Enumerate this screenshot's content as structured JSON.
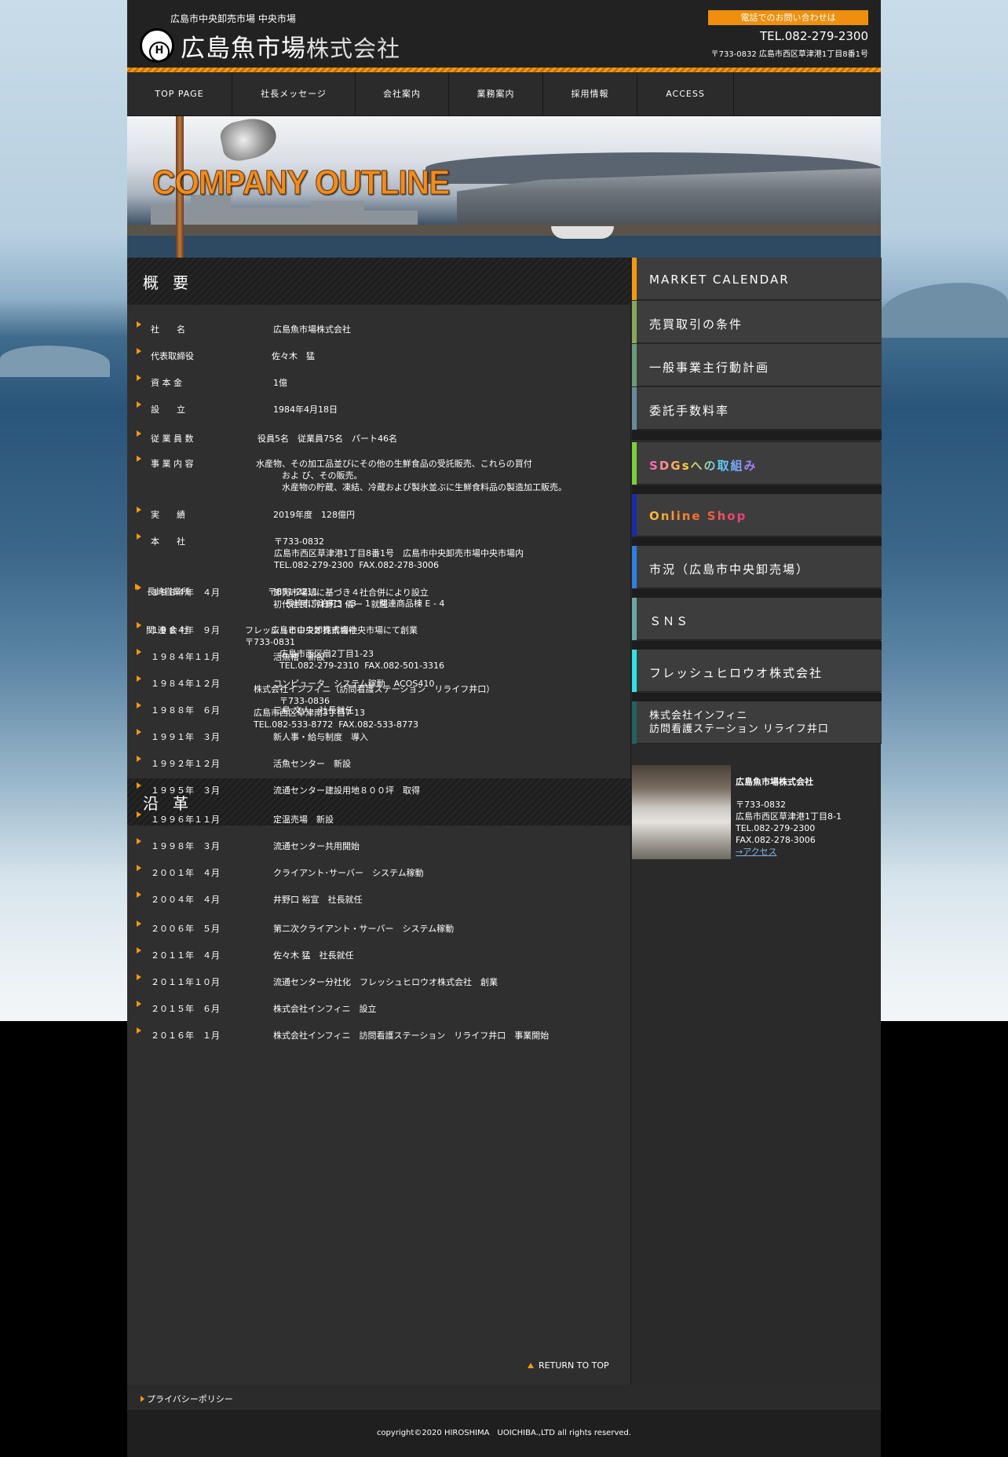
{
  "header": {
    "tagline": "広島市中央卸売市場 中央市場",
    "logo_main": "広島魚市場",
    "logo_suffix": "株式会社",
    "contact_button": "電話でのお問い合わせは",
    "tel": "TEL.082-279-2300",
    "address": "〒733-0832 広島市西区草津港1丁目8番1号"
  },
  "nav": [
    "TOP PAGE",
    "社長メッセージ",
    "会社案内",
    "業務案内",
    "採用情報",
    "ACCESS"
  ],
  "banner": {
    "title": "COMPANY OUTLINE"
  },
  "overview": {
    "heading": "概要",
    "rows": [
      {
        "label": "社　　名",
        "value": "広島魚市場株式会社"
      },
      {
        "label": "代表取締役",
        "value": "佐々木　猛"
      },
      {
        "label": "資 本 金",
        "value": "1億"
      },
      {
        "label": "設　　立",
        "value": "1984年4月18日"
      },
      {
        "label": "従 業 員 数",
        "value": "役員5名　従業員75名　パート46名"
      },
      {
        "label": "事 業 内 容",
        "value": "水産物、その加工品並びにその他の生鮮食品の受託販売、これらの買付\n　　　およ び、その販売。\n　　　水産物の貯蔵、凍結、冷蔵および製氷並ぶに生鮮食料品の製造加工販売。"
      },
      {
        "label": "実　　績",
        "value": "2019年度　128億円"
      },
      {
        "label": "本　　社",
        "value": "〒733-0832\n広島市西区草津港1丁目8番1号　広島市中央卸売市場中央市場内\nTEL.082-279-2300  FAX.082-278-3006"
      },
      {
        "label": "長崎営業所",
        "value": "〒851-2211\n　　長崎市京泊町3 - 3 - 1　関連商品棟 E - 4"
      },
      {
        "label": "関 連 会 社",
        "value": "フレッシュヒロウオ株式会社\n〒733-0831\n　　　　広島市西区扇2丁目1-23\n　　　　TEL.082-279-2310  FAX.082-501-3316\n\n　株式会社インフィニ（訪問看護ステーション　リライフ井口）\n　　　　〒733-0836\n　広島市西区草津南3丁目7-13\n　TEL.082-533-8772  FAX.082-533-8773"
      }
    ]
  },
  "history": {
    "heading": "沿革",
    "rows": [
      {
        "date": "１９８４年　４月",
        "event": "卸売市場法に基づき４社合併により設立\n初代社長に井野口 儀一　就任"
      },
      {
        "date": "１９８４年　９月",
        "event": "広島市中央卸売市場中央市場にて創業"
      },
      {
        "date": "１９８４年１１月",
        "event": "活魚槽　新設"
      },
      {
        "date": "１９８４年１２月",
        "event": "コンピュータ　システム稼動　ACOS410"
      },
      {
        "date": "１９８８年　６月",
        "event": "三島 文人　社長就任"
      },
      {
        "date": "１９９１年　３月",
        "event": "新人事・給与制度　導入"
      },
      {
        "date": "１９９２年１２月",
        "event": "活魚センター　新設"
      },
      {
        "date": "１９９５年　３月",
        "event": "流通センター建設用地８００坪　取得"
      },
      {
        "date": "１９９６年１１月",
        "event": "定温売場　新設"
      },
      {
        "date": "１９９８年　３月",
        "event": "流通センター共用開始"
      },
      {
        "date": "２００１年　４月",
        "event": "クライアント･サーバー　システム稼動"
      },
      {
        "date": "２００４年　４月",
        "event": "井野口 裕宣　社長就任"
      },
      {
        "date": "２００６年　５月",
        "event": "第二次クライアント・サーバー　システム稼動"
      },
      {
        "date": "２０１１年　４月",
        "event": "佐々木 猛　社長就任"
      },
      {
        "date": "２０１１年１０月",
        "event": "流通センター分社化　フレッシュヒロウオ株式会社　創業"
      },
      {
        "date": "２０１５年　６月",
        "event": "株式会社インフィニ　設立"
      },
      {
        "date": "２０１６年　１月",
        "event": "株式会社インフィニ　訪問看護ステーション　リライフ井口　事業開始"
      }
    ],
    "return_label": "RETURN TO TOP"
  },
  "sidebar": {
    "buttons": [
      {
        "label": "MARKET CALENDAR",
        "color": "#f29a12"
      },
      {
        "label": "売買取引の条件",
        "color": "#8aa65a"
      },
      {
        "label": "一般事業主行動計画",
        "color": "#6b9a7c"
      },
      {
        "label": "委託手数料率",
        "color": "#6b8a99"
      },
      {
        "label": "SDGsへの取組み",
        "color": "#7bcf3a"
      },
      {
        "label": "Online Shop",
        "color": "#1a2aa8"
      },
      {
        "label": "市況（広島市中央卸売場）",
        "color": "#2f7fe0"
      },
      {
        "label": "ＳＮＳ",
        "color": "#6aa6a6"
      },
      {
        "label": "フレッシュヒロウオ株式会社",
        "color": "#34e0e6"
      },
      {
        "label": "株式会社インフィニ\n訪問看護ステーション リライフ井口",
        "color": "#256060"
      }
    ],
    "company": {
      "name": "広島魚市場株式会社",
      "zip": "〒733-0832",
      "address": "広島市西区草津港1丁目8-1",
      "tel": "TEL.082-279-2300",
      "fax": "FAX.082-278-3006",
      "access_link": "→アクセス"
    }
  },
  "footer": {
    "privacy": "プライバシーポリシー",
    "copyright": "copyright©2020 HIROSHIMA　UOICHIBA.,LTD all rights reserved."
  }
}
